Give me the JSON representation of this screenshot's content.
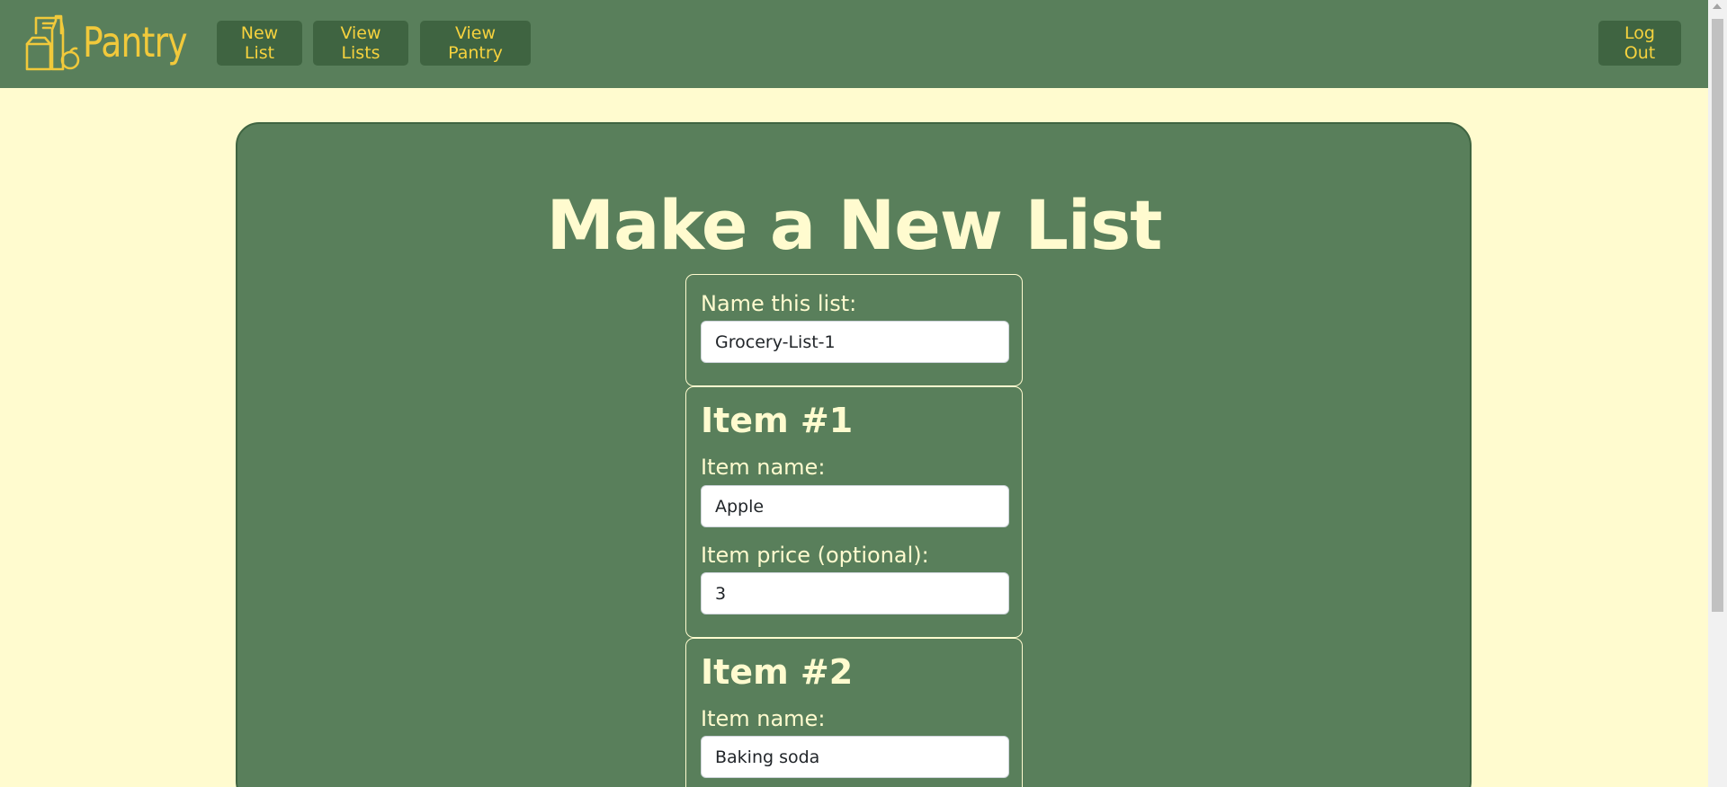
{
  "navbar": {
    "brand_name": "Pantry",
    "brand_logo_icon": "pantry-groceries-icon",
    "links": {
      "new_list": "New List",
      "view_lists": "View Lists",
      "view_pantry": "View Pantry"
    },
    "logout_label": "Log Out"
  },
  "main": {
    "title": "Make a New List",
    "list_name": {
      "label": "Name this list:",
      "value": "Grocery-List-1"
    },
    "items": [
      {
        "heading": "Item #1",
        "name_label": "Item name:",
        "name_value": "Apple",
        "price_label": "Item price (optional):",
        "price_value": "3"
      },
      {
        "heading": "Item #2",
        "name_label": "Item name:",
        "name_value": "Baking soda"
      }
    ]
  },
  "colors": {
    "page_background": "#fffbcf",
    "navbar_background": "#597f5b",
    "nav_button_background": "#3f6441",
    "brand_accent": "#f1c93b",
    "card_background": "#597f5b",
    "card_text": "#fffbcf"
  }
}
